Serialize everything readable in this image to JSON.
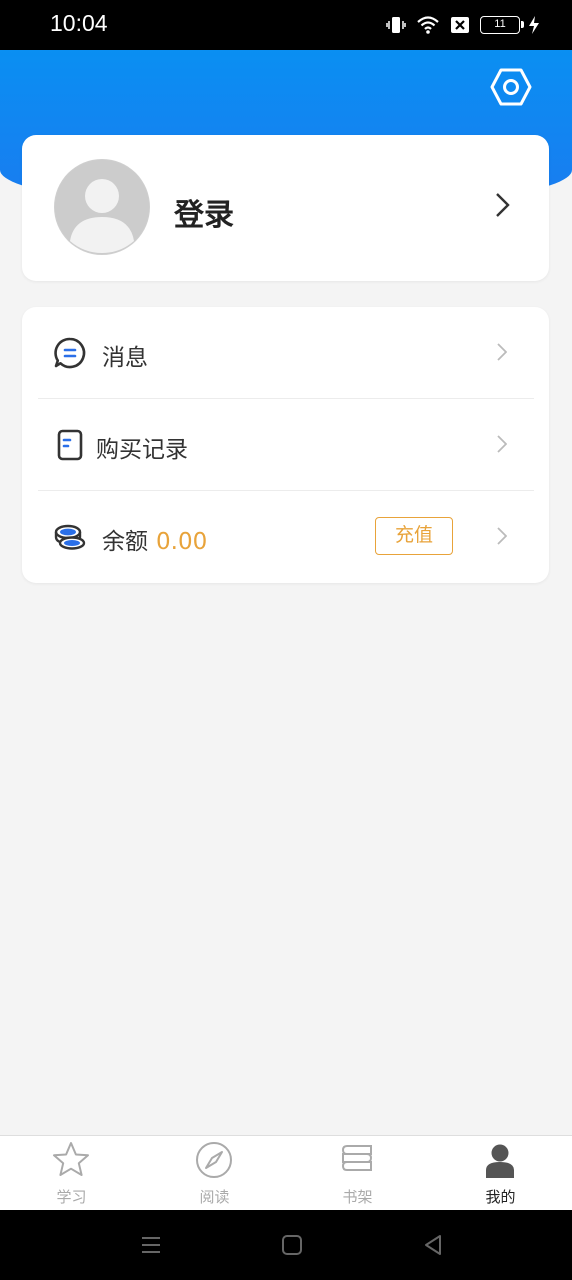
{
  "status_bar": {
    "time": "10:04",
    "battery_level": "11",
    "icons": [
      "vibrate-icon",
      "wifi-icon",
      "sim-x-icon",
      "battery-icon",
      "charging-icon"
    ]
  },
  "header": {
    "settings_icon": "settings-hexagon-icon",
    "accent_color": "#1a7bf0"
  },
  "profile": {
    "login_label": "登录",
    "avatar_icon": "default-avatar-icon"
  },
  "menu": {
    "items": [
      {
        "label": "消息",
        "icon": "message-icon"
      },
      {
        "label": "购买记录",
        "icon": "receipt-icon"
      },
      {
        "label": "余额",
        "value": "0.00",
        "icon": "coins-icon",
        "action_label": "充值"
      }
    ],
    "accent_orange": "#e8a33a"
  },
  "tab_bar": {
    "tabs": [
      {
        "label": "学习",
        "icon": "star-icon",
        "active": false
      },
      {
        "label": "阅读",
        "icon": "compass-icon",
        "active": false
      },
      {
        "label": "书架",
        "icon": "bookshelf-icon",
        "active": false
      },
      {
        "label": "我的",
        "icon": "user-icon",
        "active": true
      }
    ]
  },
  "nav_bar": {
    "buttons": [
      "menu-icon",
      "home-icon",
      "back-icon"
    ]
  }
}
